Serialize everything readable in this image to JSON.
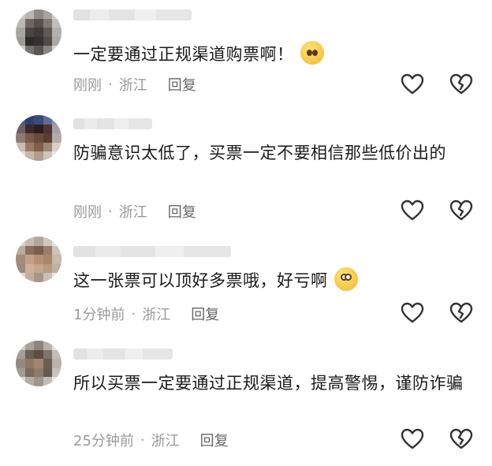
{
  "comments": [
    {
      "text": "一定要通过正规渠道购票啊！",
      "emoji": "pleading-face-icon",
      "time": "刚刚",
      "location": "浙江",
      "reply": "回复"
    },
    {
      "text": "防骗意识太低了，买票一定不要相信那些低价出的",
      "emoji": "",
      "time": "刚刚",
      "location": "浙江",
      "reply": "回复"
    },
    {
      "text": "这一张票可以顶好多票哦，好亏啊",
      "emoji": "grimacing-face-icon",
      "time": "1分钟前",
      "location": "浙江",
      "reply": "回复"
    },
    {
      "text": "所以买票一定要通过正规渠道，提高警惕，谨防诈骗",
      "emoji": "",
      "time": "25分钟前",
      "location": "浙江",
      "reply": "回复"
    }
  ],
  "separator": "·"
}
